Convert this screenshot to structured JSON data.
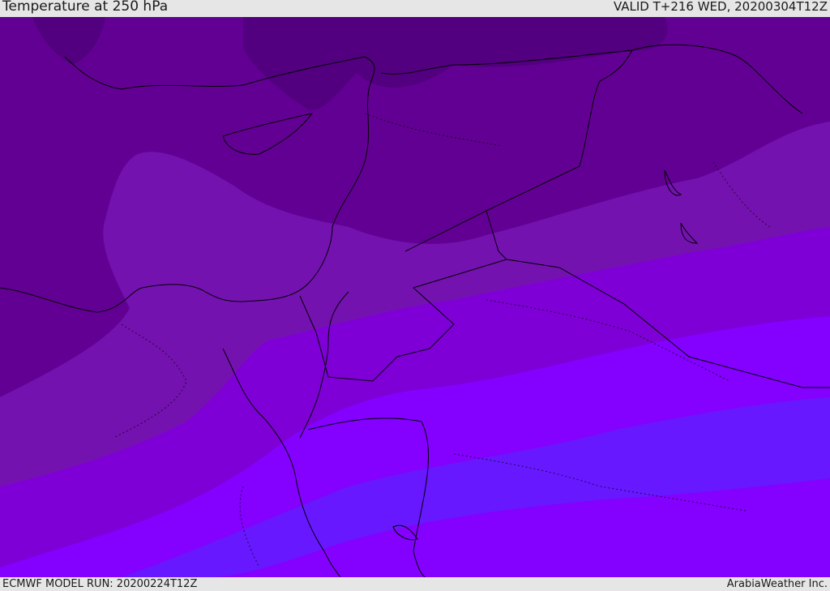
{
  "header": {
    "title": "Temperature at 250 hPa",
    "valid": "VALID T+216 WED, 20200304T12Z"
  },
  "footer": {
    "model_run": "ECMWF MODEL RUN: 20200224T12Z",
    "credit": "ArabiaWeather Inc."
  },
  "palette": {
    "band1": "#52007f",
    "band2": "#630094",
    "band3": "#7412b0",
    "band4": "#7e00d6",
    "band5": "#8400ff",
    "band6": "#6718ff",
    "coast": "#000000"
  }
}
